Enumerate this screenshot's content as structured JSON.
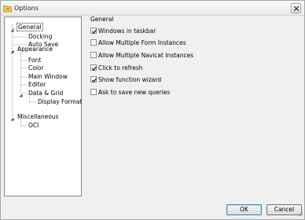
{
  "window": {
    "title": "Options"
  },
  "tree": {
    "nodes": [
      {
        "label": "General",
        "expanded": true,
        "selected": true
      },
      {
        "label": "Docking"
      },
      {
        "label": "Auto Save"
      },
      {
        "label": "Appearance",
        "expanded": true
      },
      {
        "label": "Font"
      },
      {
        "label": "Color"
      },
      {
        "label": "Main Window"
      },
      {
        "label": "Editor"
      },
      {
        "label": "Data & Grid",
        "expanded": true
      },
      {
        "label": "Display Format"
      },
      {
        "label": "Miscellaneous",
        "expanded": true
      },
      {
        "label": "OCI"
      }
    ]
  },
  "general": {
    "title": "General",
    "options": [
      {
        "label": "Windows in taskbar",
        "checked": true
      },
      {
        "label": "Allow Multiple Form Instances",
        "checked": false
      },
      {
        "label": "Allow Multiple Navicat Instances",
        "checked": false
      },
      {
        "label": "Click to refresh",
        "checked": true
      },
      {
        "label": "Show function wizard",
        "checked": true
      },
      {
        "label": "Ask to save new queries",
        "checked": false
      }
    ]
  },
  "buttons": {
    "ok": "OK",
    "cancel": "Cancel"
  },
  "colors": {
    "accent_border": "#3c7fb1",
    "tree_line": "#a0a0a0",
    "check_mark": "#1b2f4e"
  },
  "icons": [
    "folder-key-icon",
    "close-icon",
    "expander-icon",
    "check-icon",
    "resize-grip-icon"
  ]
}
